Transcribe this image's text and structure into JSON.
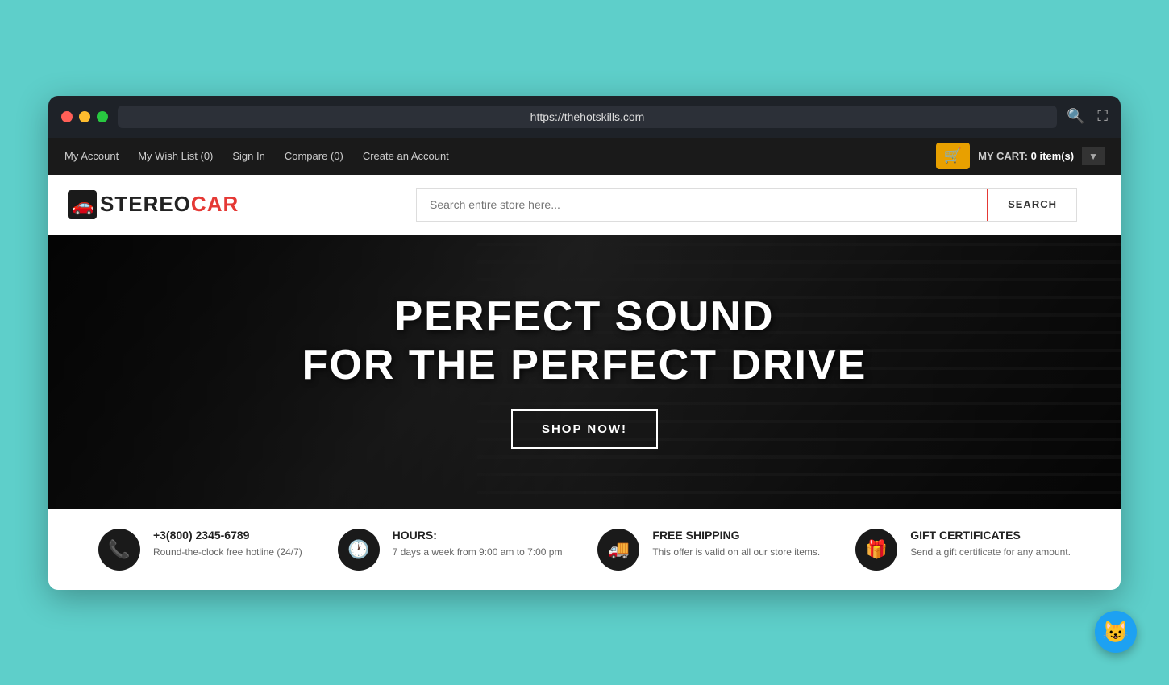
{
  "browser": {
    "url": "https://thehotskills.com",
    "traffic_lights": [
      "red",
      "yellow",
      "green"
    ]
  },
  "top_nav": {
    "links": [
      {
        "label": "My Account",
        "id": "my-account"
      },
      {
        "label": "My Wish List (0)",
        "id": "wish-list"
      },
      {
        "label": "Sign In",
        "id": "sign-in"
      },
      {
        "label": "Compare (0)",
        "id": "compare"
      },
      {
        "label": "Create an Account",
        "id": "create-account"
      }
    ],
    "cart_label": "MY CART:",
    "cart_count": "0 item(s)"
  },
  "header": {
    "logo_stereo": "STEREO",
    "logo_car": "CAR",
    "search_placeholder": "Search entire store here...",
    "search_button_label": "SEARCH"
  },
  "hero": {
    "title_line1": "PERFECT SOUND",
    "title_line2": "FOR THE PERFECT DRIVE",
    "cta_label": "SHOP NOW!"
  },
  "features": [
    {
      "icon": "📞",
      "title": "+3(800) 2345-6789",
      "description": "Round-the-clock free hotline (24/7)"
    },
    {
      "icon": "🕐",
      "title": "HOURS:",
      "description": "7 days a week from 9:00 am to 7:00 pm"
    },
    {
      "icon": "🚚",
      "title": "FREE SHIPPING",
      "description": "This offer is valid on all our store items."
    },
    {
      "icon": "🎁",
      "title": "GIFT CERTIFICATES",
      "description": "Send a gift certificate for any amount."
    }
  ]
}
